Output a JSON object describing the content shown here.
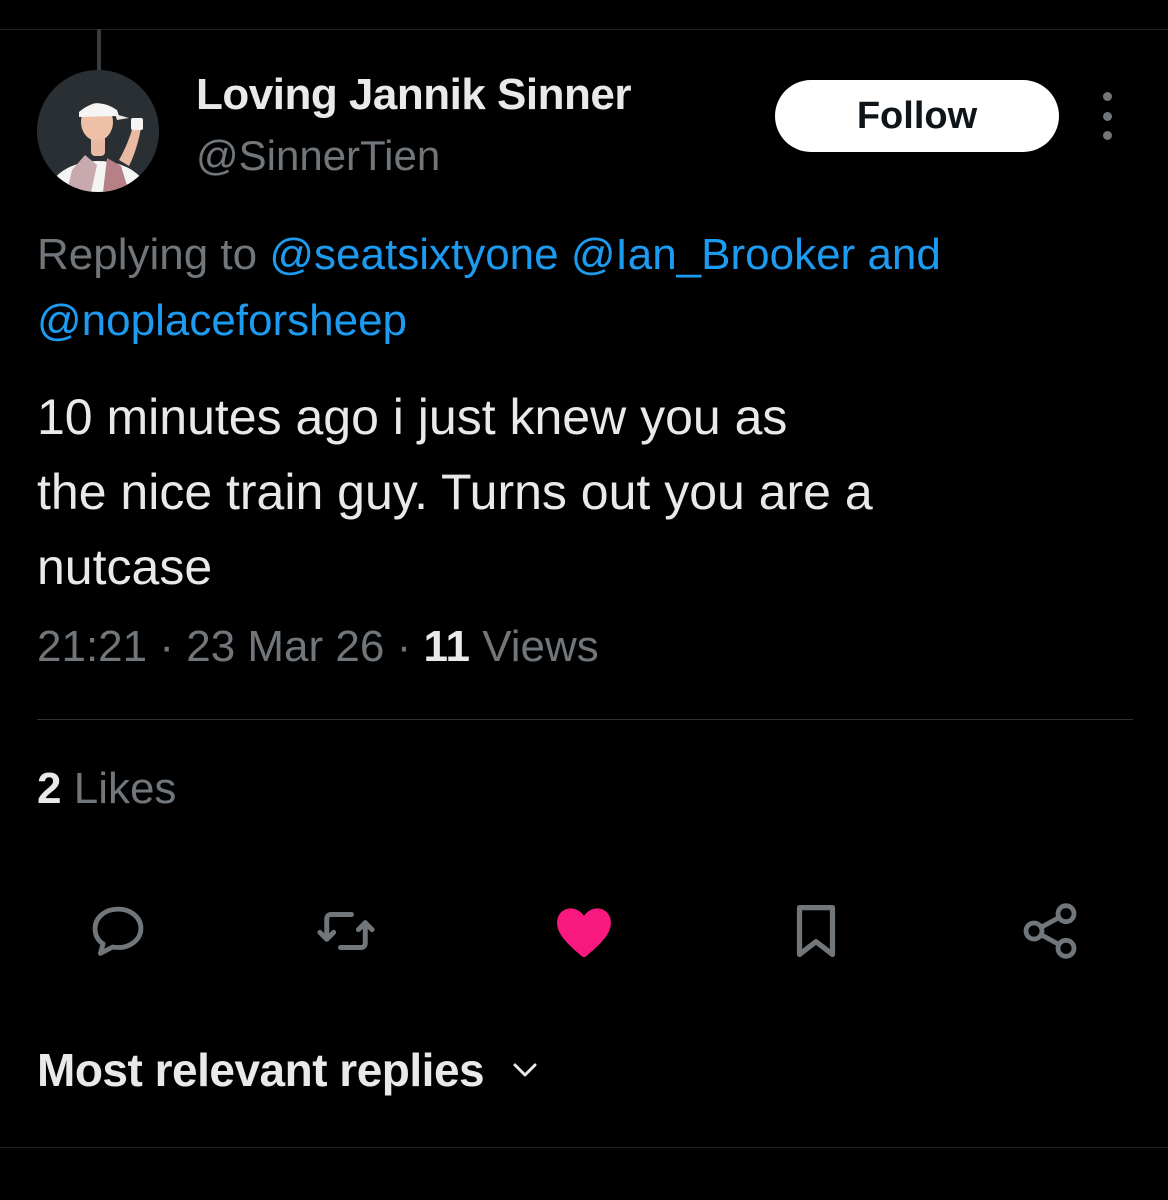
{
  "tweet": {
    "author": {
      "display_name": "Loving Jannik Sinner",
      "handle": "@SinnerTien",
      "avatar_icon": "profile-photo"
    },
    "follow_label": "Follow",
    "more_icon": "more-vertical-icon",
    "reply_context": {
      "prefix": "Replying to ",
      "mentions": [
        "@seatsixtyone",
        "@Ian_Brooker"
      ],
      "conjunction": "and",
      "last_mention": "@noplaceforsheep"
    },
    "text_lines": [
      "10 minutes ago i just knew you as",
      "the nice train guy. Turns out you are a",
      "nutcase"
    ],
    "time": "21:21",
    "separator": "·",
    "date": "23 Mar 26",
    "views_count": "11",
    "views_label": "Views",
    "likes_count": "2",
    "likes_label": "Likes"
  },
  "actions": [
    {
      "name": "reply",
      "icon": "reply-icon"
    },
    {
      "name": "retweet",
      "icon": "retweet-icon"
    },
    {
      "name": "like",
      "icon": "heart-icon",
      "active": true
    },
    {
      "name": "bookmark",
      "icon": "bookmark-icon"
    },
    {
      "name": "share",
      "icon": "share-icon"
    }
  ],
  "replies_sort": {
    "label": "Most relevant replies",
    "icon": "chevron-down-icon"
  },
  "colors": {
    "background": "#000000",
    "text_primary": "#e7e9ea",
    "text_secondary": "#71767b",
    "link": "#1d9bf0",
    "like_active": "#f91880",
    "follow_button_bg": "#ffffff"
  }
}
